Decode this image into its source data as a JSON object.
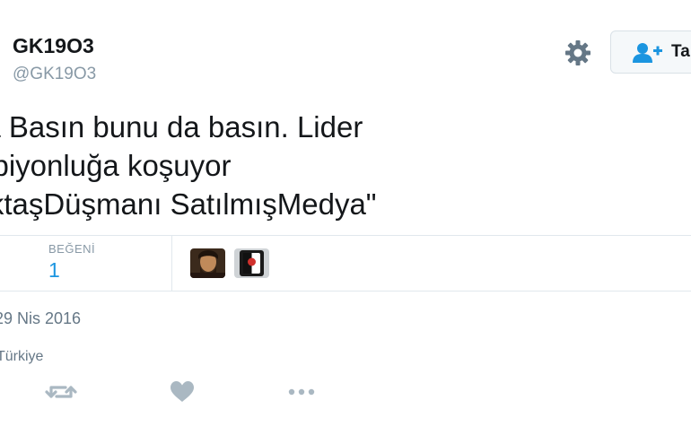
{
  "user": {
    "display_name": "GK19O3",
    "handle": "@GK19O3"
  },
  "header": {
    "follow_label": "Ta"
  },
  "tweet": {
    "lines": [
      "ba Basın bunu da basın. Lider",
      "mpiyonluğa koşuyor",
      "şiktaşDüşmanı SatılmışMedya\""
    ]
  },
  "stats": {
    "likes_label": "BEĞENİ",
    "likes_count": "1"
  },
  "meta": {
    "date": "29 Nis 2016",
    "location": "Türkiye"
  },
  "icons": {
    "settings": "gear-icon",
    "follow": "add-user-icon",
    "retweet": "retweet-icon",
    "like": "heart-icon",
    "more": "more-icon"
  },
  "colors": {
    "primary_text": "#14171a",
    "secondary_text": "#8899a6",
    "accent": "#1b95e0",
    "icon_gray": "#aab8c2"
  }
}
